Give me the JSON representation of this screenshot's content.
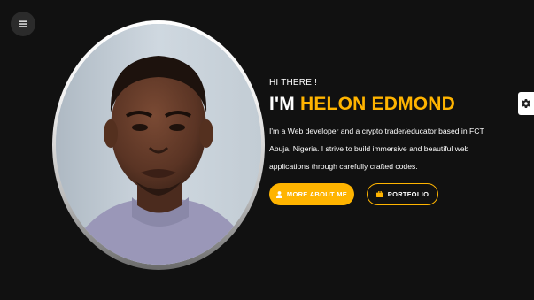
{
  "colors": {
    "accent": "#ffb400",
    "background": "#111111",
    "text": "#ffffff"
  },
  "icons": {
    "menu": "hamburger-icon",
    "settings": "gear-icon",
    "about": "user-icon",
    "portfolio": "briefcase-icon"
  },
  "hero": {
    "eyebrow": "HI THERE !",
    "greeting": "I'M",
    "name": "HELON EDMOND",
    "bio": "I'm a Web developer and a crypto trader/educator based in FCT Abuja, Nigeria. I strive to build immersive and beautiful web applications through carefully crafted codes."
  },
  "buttons": {
    "about_label": "MORE ABOUT ME",
    "portfolio_label": "PORTFOLIO"
  }
}
